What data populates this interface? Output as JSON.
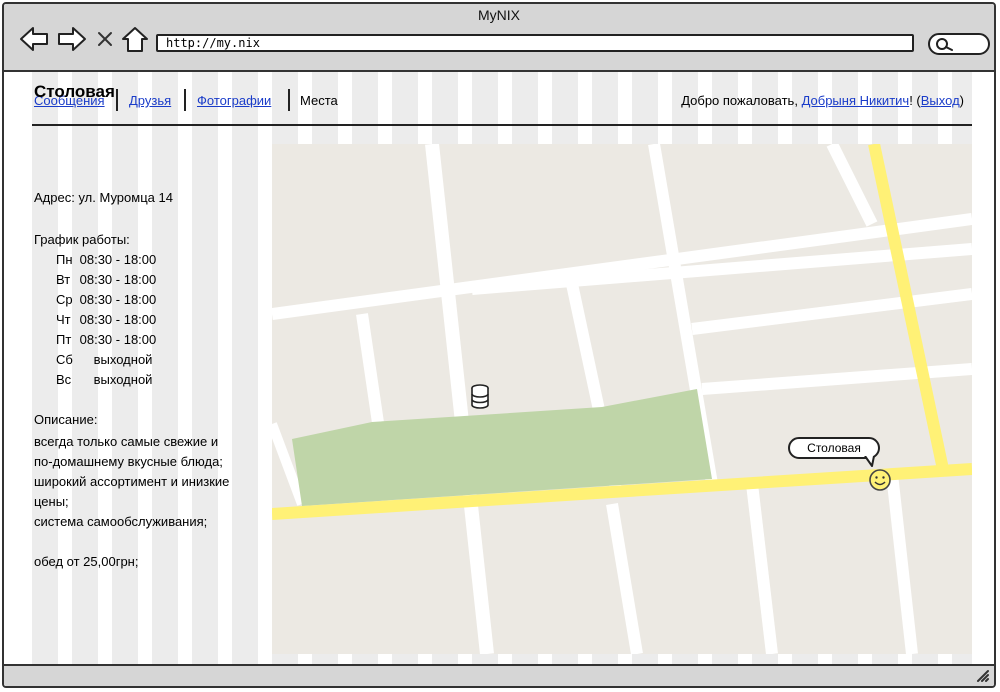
{
  "window": {
    "title": "MyNIX"
  },
  "browser": {
    "url": "http://my.nix",
    "icons": {
      "back": "arrow-left-icon",
      "forward": "arrow-right-icon",
      "stop": "close-icon",
      "home": "home-icon",
      "search": "search-icon"
    }
  },
  "nav": {
    "items": [
      {
        "label": "Сообщения",
        "link": true
      },
      {
        "label": "Друзья",
        "link": true
      },
      {
        "label": "Фотографии",
        "link": true
      },
      {
        "label": "Места",
        "link": false
      }
    ],
    "welcome_prefix": "Добро пожаловать, ",
    "user_name": "Добрыня Никитич",
    "welcome_mid": "! (",
    "logout": "Выход",
    "welcome_suffix": ")"
  },
  "place": {
    "title": "Столовая",
    "address": "Адрес: ул. Муромца 14",
    "schedule_label": "График работы:",
    "schedule": [
      {
        "day": "Пн",
        "time": "08:30 - 18:00"
      },
      {
        "day": "Вт",
        "time": "08:30 - 18:00"
      },
      {
        "day": "Ср",
        "time": "08:30 - 18:00"
      },
      {
        "day": "Чт",
        "time": "08:30 - 18:00"
      },
      {
        "day": "Пт",
        "time": "08:30 - 18:00"
      },
      {
        "day": "Сб",
        "time": "выходной"
      },
      {
        "day": "Вс",
        "time": "выходной"
      }
    ],
    "description_label": "Описание:",
    "description_lines": [
      "всегда только самые свежие и",
      "по-домашнему вкусные блюда;",
      "широкий ассортимент и инизкие",
      "цены;",
      "система самообслуживания;"
    ],
    "price": "обед от 25,00грн;"
  },
  "map": {
    "marker_label": "Столовая",
    "marker_icon": "smiley-icon",
    "poi_icon": "database-icon",
    "colors": {
      "background": "#ece9e3",
      "road": "#ffffff",
      "highway": "#fff176",
      "park": "#bfd5a8"
    }
  }
}
